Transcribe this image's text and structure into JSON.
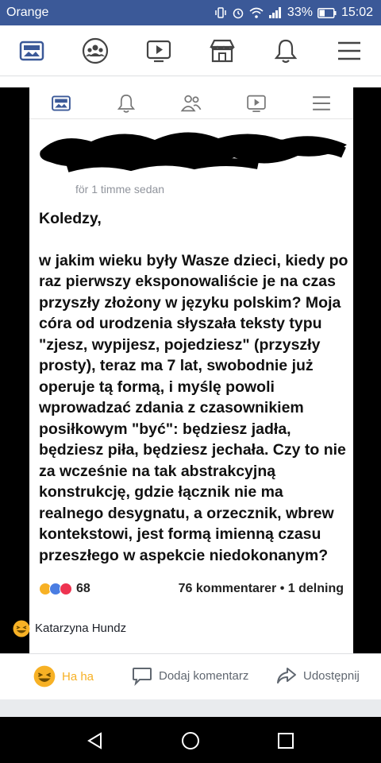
{
  "status_bar": {
    "carrier": "Orange",
    "battery": "33%",
    "time": "15:02"
  },
  "top_nav": {
    "icons": [
      "news-feed-icon",
      "groups-icon",
      "watch-icon",
      "marketplace-icon",
      "notifications-icon",
      "menu-icon"
    ]
  },
  "embedded": {
    "timestamp": "för 1 timme sedan",
    "greeting": "Koledzy,",
    "message": "w jakim wieku były Wasze dzieci, kiedy po raz pierwszy eksponowaliście je na czas przyszły złożony w języku polskim? Moja córa od urodzenia słyszała teksty typu \"zjesz, wypijesz, pojedziesz\" (przyszły prosty), teraz ma 7 lat, swobodnie już operuje tą formą, i myślę powoli wprowadzać zdania z czasownikiem posiłkowym \"być\": będziesz jadła, będziesz piła, będziesz jechała. Czy to nie za wcześnie na tak abstrakcyjną konstrukcję, gdzie łącznik nie ma realnego desygnatu, a orzecznik, wbrew kontekstowi, jest formą imienną czasu przeszłego w aspekcie niedokonanym?",
    "reaction_count": "68",
    "comments_meta": "76 kommentarer • 1 delning"
  },
  "reactor": {
    "name": "Katarzyna Hundz"
  },
  "actions": {
    "haha": "Ha ha",
    "comment": "Dodaj komentarz",
    "share": "Udostępnij"
  },
  "colors": {
    "brand": "#3b5998",
    "haha": "#f7b125"
  }
}
